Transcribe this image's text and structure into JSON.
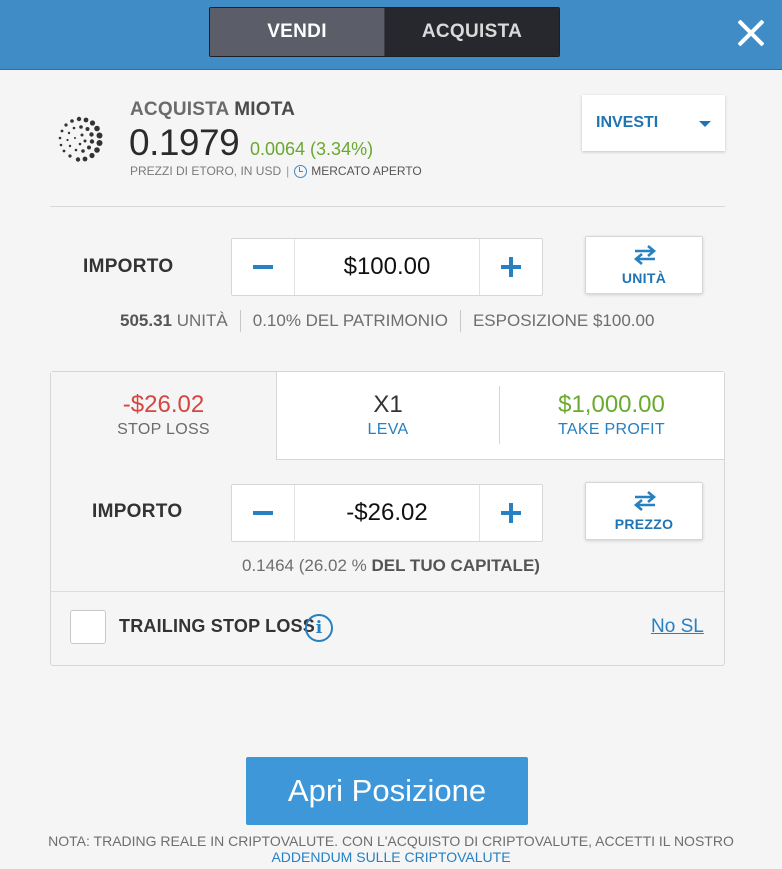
{
  "header": {
    "sell_label": "VENDI",
    "buy_label": "ACQUISTA",
    "close_icon": "close-icon",
    "accent_color": "#3f8cc7"
  },
  "instrument": {
    "action": "ACQUISTA",
    "ticker": "MIOTA",
    "price": "0.1979",
    "change": "0.0064 (3.34%)",
    "prices_note": "PREZZI DI ETORO, IN USD",
    "separator": "|",
    "market_status": "MERCATO APERTO",
    "logo_icon": "iota-logo-icon",
    "clock_icon": "clock-icon"
  },
  "mode_dropdown": {
    "label": "INVESTI",
    "icon": "caret-down-icon"
  },
  "amount": {
    "label": "IMPORTO",
    "value": "$100.00",
    "switch_label": "UNITÀ",
    "switch_icon": "swap-arrows-icon"
  },
  "amount_info": {
    "units_value": "505.31",
    "units_label": "UNITÀ",
    "equity": "0.10% DEL PATRIMONIO",
    "exposure_label": "ESPOSIZIONE",
    "exposure_value": "$100.00"
  },
  "tabs": {
    "stop_loss": {
      "value": "-$26.02",
      "label": "STOP LOSS",
      "color": "#d64541"
    },
    "leverage": {
      "value": "X1",
      "label": "LEVA"
    },
    "take_profit": {
      "value": "$1,000.00",
      "label": "TAKE PROFIT",
      "color": "#6aab2f"
    }
  },
  "stop_loss_panel": {
    "label": "IMPORTO",
    "value": "-$26.02",
    "switch_label": "PREZZO",
    "switch_icon": "swap-arrows-icon",
    "rate": "0.1464",
    "pct_prefix": "(26.02 %",
    "pct_suffix": "DEL TUO CAPITALE)",
    "trailing_label": "TRAILING STOP LOSS",
    "trailing_checked": false,
    "info_icon": "info-icon",
    "no_sl_link": "No SL"
  },
  "submit": {
    "label": "Apri Posizione"
  },
  "footer": {
    "note": "NOTA: TRADING REALE IN CRIPTOVALUTE. CON L'ACQUISTO DI CRIPTOVALUTE, ACCETTI IL NOSTRO",
    "link": "ADDENDUM SULLE CRIPTOVALUTE"
  }
}
